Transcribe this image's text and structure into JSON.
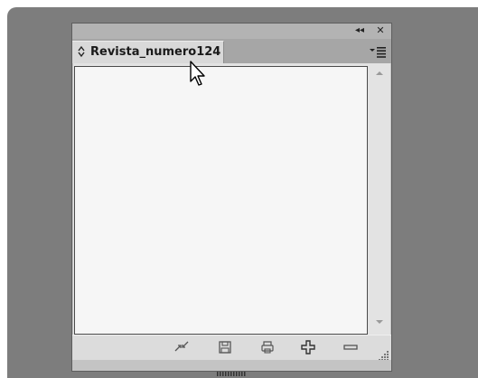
{
  "panel": {
    "tab_label": "Revista_numero124",
    "controls": {
      "collapse": "◂◂",
      "close": "✕"
    },
    "icons": {
      "tab_order": "updown-arrows-icon",
      "panel_menu": "panel-menu-icon",
      "relink": "relink-icon",
      "save": "save-icon",
      "print": "print-icon",
      "add": "add-icon",
      "remove": "remove-icon"
    }
  },
  "colors": {
    "backdrop": "#7d7d7d",
    "panel": "#c4c4c4",
    "list_area": "#f6f6f6",
    "tab_active": "#d9d9d9"
  }
}
